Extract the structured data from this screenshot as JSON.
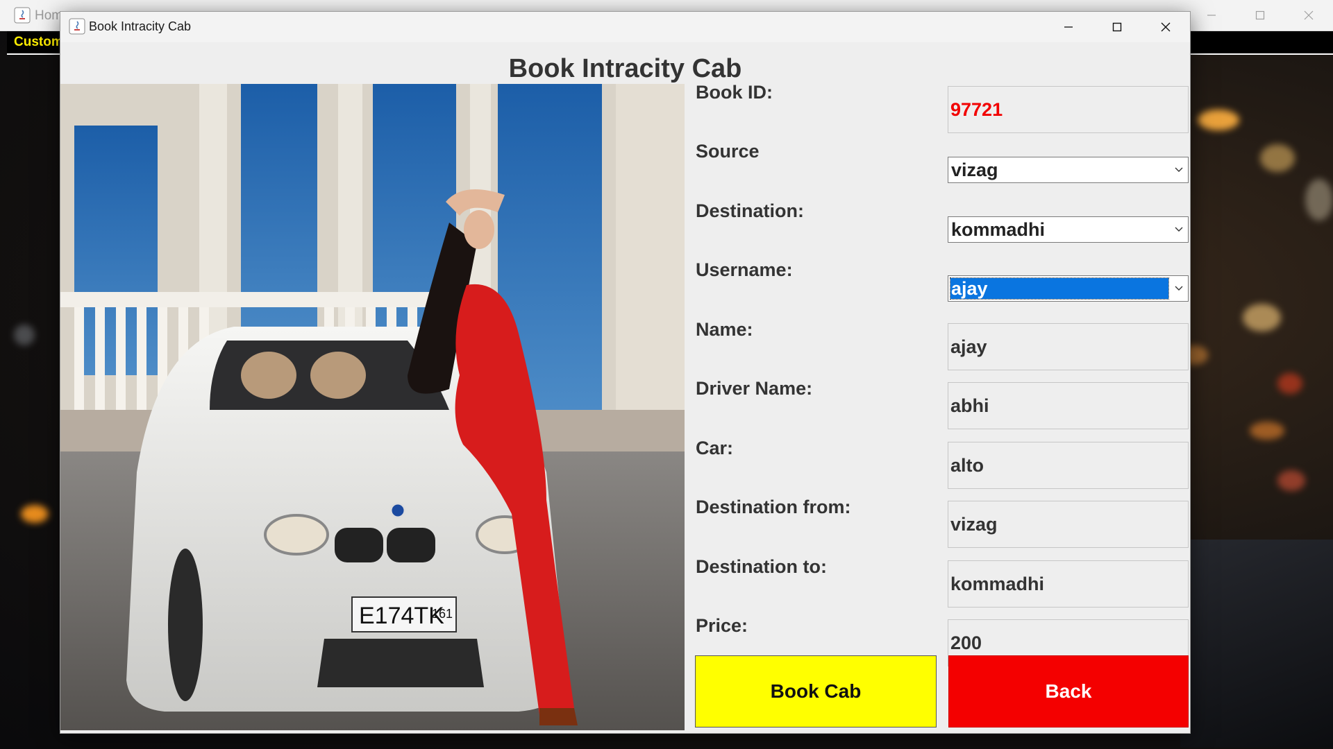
{
  "parent_window": {
    "title": "Home",
    "menu_item": "Customer"
  },
  "window": {
    "title": "Book Intracity Cab",
    "heading": "Book Intracity Cab"
  },
  "form": {
    "book_id": {
      "label": "Book ID:",
      "value": "97721"
    },
    "source": {
      "label": "Source",
      "value": "vizag"
    },
    "destination": {
      "label": "Destination:",
      "value": "kommadhi"
    },
    "username": {
      "label": "Username:",
      "value": "ajay"
    },
    "name": {
      "label": "Name:",
      "value": "ajay"
    },
    "driver_name": {
      "label": "Driver Name:",
      "value": "abhi"
    },
    "car": {
      "label": "Car:",
      "value": "alto"
    },
    "destination_from": {
      "label": "Destination from:",
      "value": "vizag"
    },
    "destination_to": {
      "label": "Destination to:",
      "value": "kommadhi"
    },
    "price": {
      "label": "Price:",
      "value": "200"
    }
  },
  "buttons": {
    "book_cab": "Book Cab",
    "back": "Back"
  },
  "image": {
    "plate": "E174TK",
    "region": "161"
  },
  "colors": {
    "book_id_text": "#f20000",
    "book_button": "#ffff00",
    "back_button": "#f40000",
    "selection": "#0a75e0",
    "menu_text": "#ffee00"
  }
}
